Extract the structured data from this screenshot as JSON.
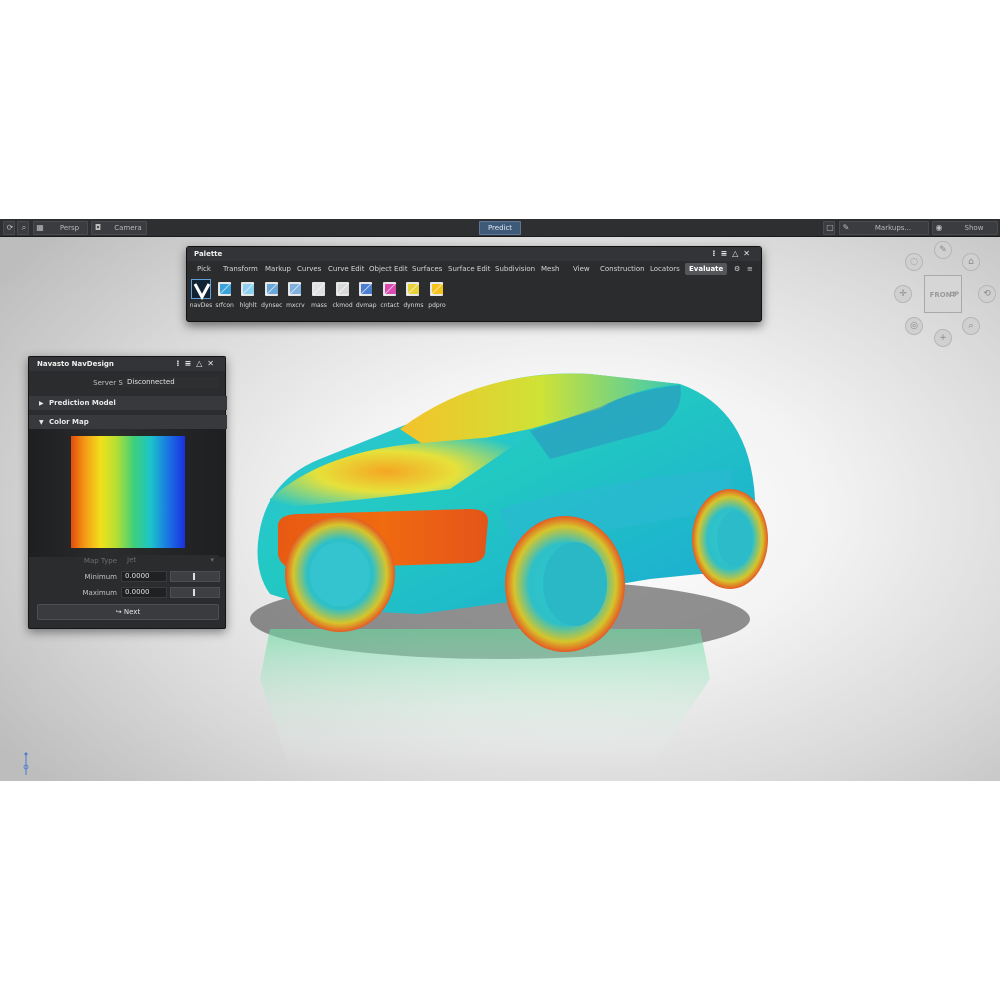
{
  "topbar": {
    "persp_label": "Persp",
    "camera_label": "Camera",
    "predict_label": "Predict",
    "markups_label": "Markups...",
    "show_label": "Show"
  },
  "palette": {
    "title": "Palette",
    "tabs": [
      {
        "label": "Pick"
      },
      {
        "label": "Transform"
      },
      {
        "label": "Markup"
      },
      {
        "label": "Curves"
      },
      {
        "label": "Curve Edit"
      },
      {
        "label": "Object Edit"
      },
      {
        "label": "Surfaces"
      },
      {
        "label": "Surface Edit"
      },
      {
        "label": "Subdivision"
      },
      {
        "label": "Mesh"
      },
      {
        "label": "View"
      },
      {
        "label": "Construction"
      },
      {
        "label": "Locators"
      },
      {
        "label": "Evaluate",
        "active": true
      }
    ],
    "tools": [
      {
        "label": "navDes",
        "icon": "navdesign-v-icon",
        "selected": true
      },
      {
        "label": "srfcon",
        "icon": "surface-continuity-icon"
      },
      {
        "label": "hlghlt",
        "icon": "highlight-icon"
      },
      {
        "label": "dynsec",
        "icon": "dynamic-section-icon"
      },
      {
        "label": "mxcrv",
        "icon": "max-curvature-icon"
      },
      {
        "label": "mass",
        "icon": "mass-icon"
      },
      {
        "label": "ckmod",
        "icon": "check-model-icon"
      },
      {
        "label": "dvmap",
        "icon": "deviation-map-icon"
      },
      {
        "label": "cntact",
        "icon": "contact-icon"
      },
      {
        "label": "dynms",
        "icon": "dynamic-mesh-icon"
      },
      {
        "label": "pdpro",
        "icon": "pdpro-icon"
      }
    ]
  },
  "navdesign": {
    "title": "Navasto NavDesign",
    "server_status_label": "Server Status:",
    "server_status_value": "Disconnected",
    "prediction_model_label": "Prediction Model",
    "color_map_label": "Color Map",
    "map_type_label": "Map Type",
    "map_type_value": "Jet",
    "minimum_label": "Minimum",
    "minimum_value": "0.0000",
    "maximum_label": "Maximum",
    "maximum_value": "0.0000",
    "next_label": "Next"
  },
  "viewcube": {
    "front_label": "FRONT",
    "up_label": "UP"
  },
  "colors": {
    "accent": "#3f5a78",
    "panel_bg": "#2b2c2e",
    "jet_low": "#1b30e0",
    "jet_high": "#e24b0b"
  }
}
